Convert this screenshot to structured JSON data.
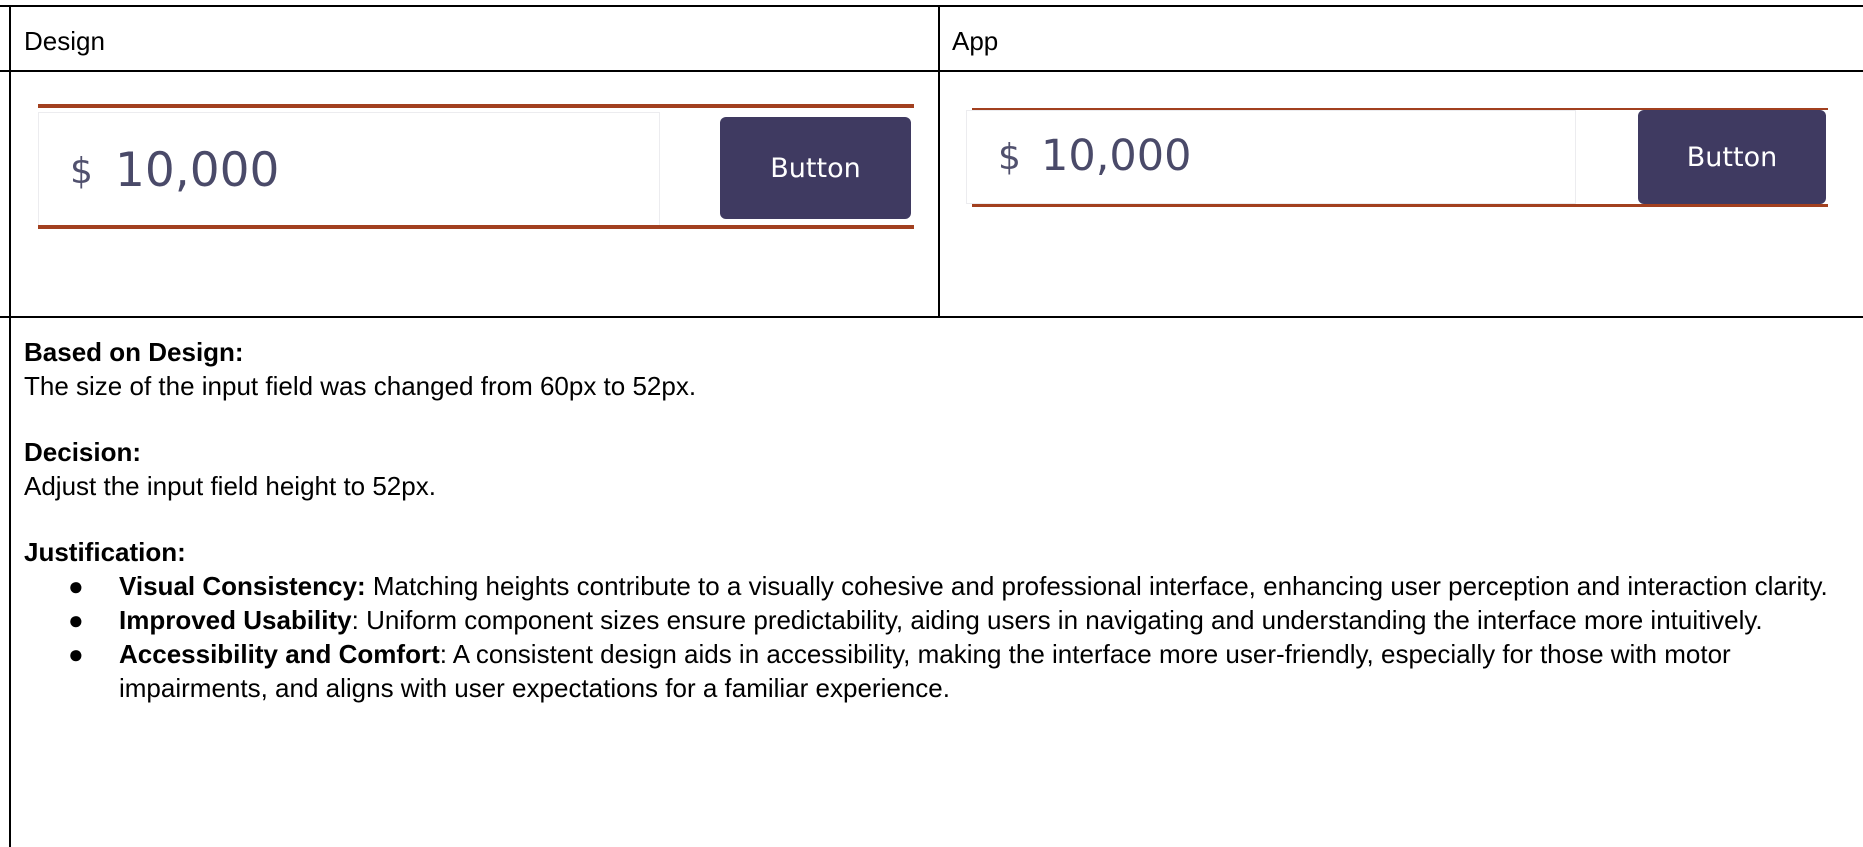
{
  "table": {
    "header_left": "Design",
    "header_right": "App"
  },
  "design_preview": {
    "currency": "$",
    "amount": "10,000",
    "button_label": "Button"
  },
  "app_preview": {
    "currency": "$",
    "amount": "10,000",
    "button_label": "Button"
  },
  "notes": {
    "based_on_heading": "Based on Design:",
    "based_on_text": "The size of the input field was changed from 60px to 52px.",
    "decision_heading": "Decision:",
    "decision_text": "Adjust the input field height to 52px.",
    "justification_heading": "Justification:",
    "items": [
      {
        "title": "Visual Consistency:",
        "text": " Matching heights contribute to a visually cohesive and professional interface, enhancing user perception and interaction clarity."
      },
      {
        "title": "Improved Usability",
        "text": ": Uniform component sizes ensure predictability, aiding users in navigating and understanding the interface more intuitively."
      },
      {
        "title": "Accessibility and Comfort",
        "text": ": A consistent design aids in accessibility, making the interface more user-friendly, especially for those with motor impairments, and aligns with user expectations for a familiar experience."
      }
    ]
  },
  "colors": {
    "accent_rule": "#a2401f",
    "button_bg": "#3f3a61",
    "value_text": "#4a4a69"
  }
}
